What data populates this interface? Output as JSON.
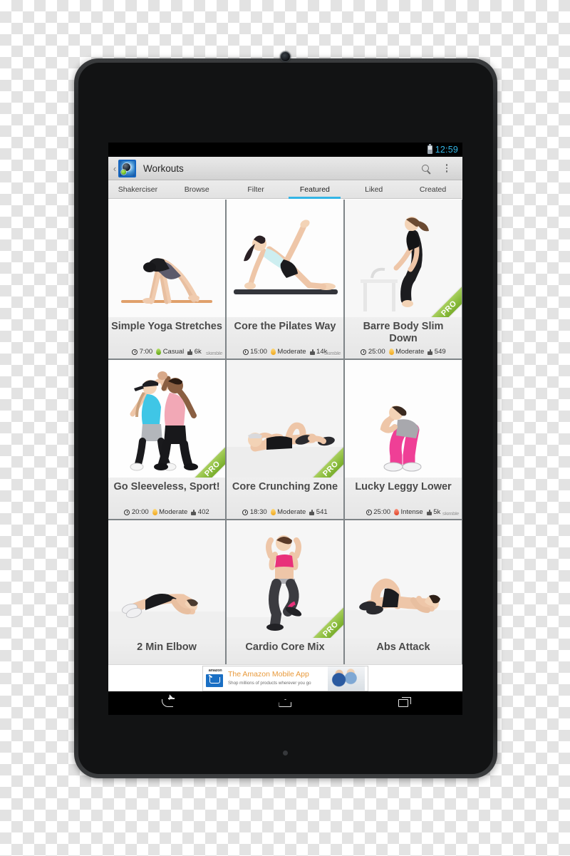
{
  "status_bar": {
    "time": "12:59",
    "battery_icon": "battery-icon"
  },
  "action_bar": {
    "app_icon": "workouts-app-icon",
    "title": "Workouts",
    "up_caret": "‹",
    "search_icon": "search-icon",
    "overflow_icon": "overflow-menu-icon"
  },
  "tabs": [
    {
      "label": "Shakerciser",
      "active": false
    },
    {
      "label": "Browse",
      "active": false
    },
    {
      "label": "Filter",
      "active": false
    },
    {
      "label": "Featured",
      "active": true
    },
    {
      "label": "Liked",
      "active": false
    },
    {
      "label": "Created",
      "active": false
    }
  ],
  "accent_color": "#33b5e5",
  "pro_label": "PRO",
  "watermark": "skimble",
  "workouts": [
    {
      "title": "Simple Yoga Stretches",
      "duration": "7:00",
      "intensity": "Casual",
      "intensity_level": "casual",
      "likes": "6k",
      "pro": false,
      "watermark": true,
      "image": "downward-dog-yoga-pose"
    },
    {
      "title": "Core the Pilates Way",
      "duration": "15:00",
      "intensity": "Moderate",
      "intensity_level": "moderate",
      "likes": "14k",
      "pro": false,
      "watermark": true,
      "image": "pilates-side-plank-leg-raise"
    },
    {
      "title": "Barre Body Slim Down",
      "duration": "25:00",
      "intensity": "Moderate",
      "intensity_level": "moderate",
      "likes": "549",
      "pro": true,
      "watermark": false,
      "image": "barre-chair-exercise"
    },
    {
      "title": "Go Sleeveless, Sport!",
      "duration": "20:00",
      "intensity": "Moderate",
      "intensity_level": "moderate",
      "likes": "402",
      "pro": true,
      "watermark": false,
      "image": "partner-high-five-workout"
    },
    {
      "title": "Core Crunching Zone",
      "duration": "18:30",
      "intensity": "Moderate",
      "intensity_level": "moderate",
      "likes": "541",
      "pro": true,
      "watermark": false,
      "image": "floor-crunch-exercise"
    },
    {
      "title": "Lucky Leggy Lower",
      "duration": "25:00",
      "intensity": "Intense",
      "intensity_level": "intense",
      "likes": "5k",
      "pro": false,
      "watermark": true,
      "image": "squat-exercise-pink-leggings"
    },
    {
      "title": "2 Min Elbow",
      "duration": "",
      "intensity": "",
      "intensity_level": "",
      "likes": "",
      "pro": false,
      "watermark": true,
      "image": "elbow-plank-exercise"
    },
    {
      "title": "Cardio Core Mix",
      "duration": "",
      "intensity": "",
      "intensity_level": "",
      "likes": "",
      "pro": true,
      "watermark": false,
      "image": "cardio-high-knee-exercise"
    },
    {
      "title": "Abs Attack",
      "duration": "",
      "intensity": "",
      "intensity_level": "",
      "likes": "",
      "pro": false,
      "watermark": true,
      "image": "side-crunch-abs-exercise"
    }
  ],
  "ad": {
    "brand": "amazon",
    "title": "The Amazon Mobile App",
    "subtitle": "Shop millions of products wherever you go",
    "cart_icon": "shopping-cart-icon"
  },
  "nav_bar": {
    "back": "back-button",
    "home": "home-button",
    "recents": "recent-apps-button"
  }
}
